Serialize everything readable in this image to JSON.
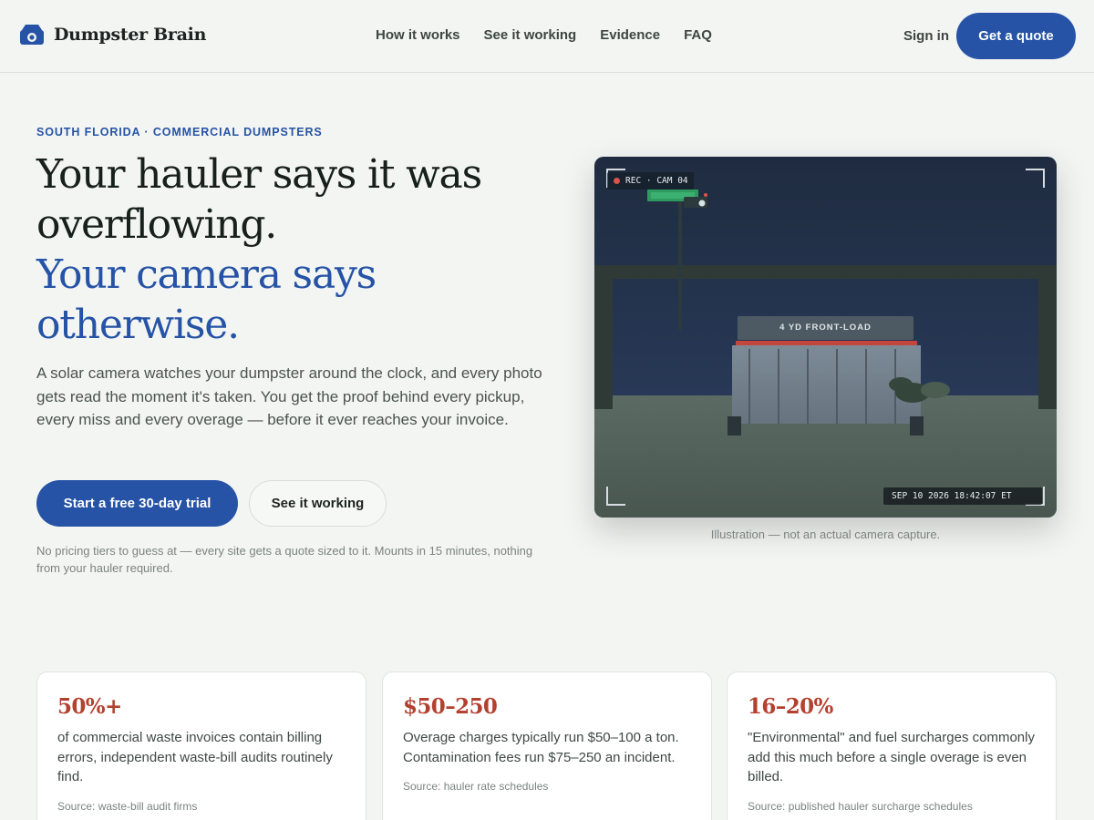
{
  "brand": {
    "name": "Dumpster Brain",
    "icon": "dumpster-camera-icon",
    "accent": "#2653a6"
  },
  "nav": {
    "items": [
      "How it works",
      "See it working",
      "Evidence",
      "FAQ"
    ],
    "signin": "Sign in",
    "quote": "Get a quote"
  },
  "hero": {
    "eyebrow": "SOUTH FLORIDA · COMMERCIAL DUMPSTERS",
    "headline_line1": "Your hauler says it was overflowing.",
    "headline_line2": "Your camera says otherwise.",
    "lead": "A solar camera watches your dumpster around the clock, and every photo gets read the moment it's taken. You get the proof behind every pickup, every miss and every overage — before it ever reaches your invoice.",
    "cta_primary": "Start a free 30-day trial",
    "cta_secondary": "See it working",
    "fineprint": "No pricing tiers to guess at — every site gets a quote sized to it. Mounts in 15 minutes, nothing from your hauler required."
  },
  "camera": {
    "rec_label": "REC · CAM 04",
    "dumpster_label": "4 YD FRONT-LOAD",
    "timestamp": "SEP 10 2026 18:42:07 ET",
    "caption": "Illustration — not an actual camera capture."
  },
  "stats": [
    {
      "value": "50%+",
      "desc": "of commercial waste invoices contain billing errors, independent waste-bill audits routinely find.",
      "source": "Source: waste-bill audit firms"
    },
    {
      "value": "$50–250",
      "desc": "Overage charges typically run $50–100 a ton. Contamination fees run $75–250 an incident.",
      "source": "Source: hauler rate schedules"
    },
    {
      "value": "16–20%",
      "desc": "\"Environmental\" and fuel surcharges commonly add this much before a single overage is even billed.",
      "source": "Source: published hauler surcharge schedules"
    }
  ],
  "colors": {
    "primary": "#2653a6",
    "stat": "#b3412f",
    "background": "#f3f5f3"
  }
}
